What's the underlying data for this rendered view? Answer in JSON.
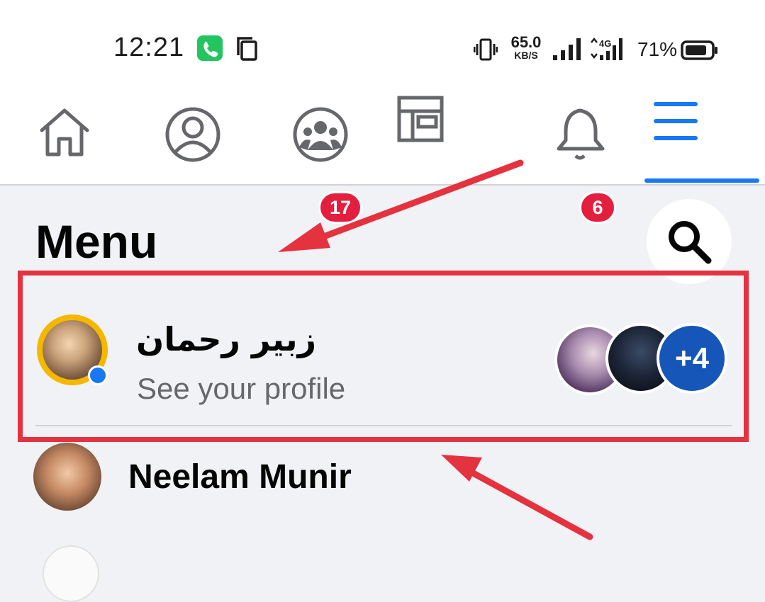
{
  "status_bar": {
    "time": "12:21",
    "speed_value": "65.0",
    "speed_unit": "KB/S",
    "battery_percent": "71%",
    "icons": [
      "call-icon",
      "copy-icon",
      "vibrate-icon",
      "signal-icon",
      "4g-signal-icon",
      "battery-icon"
    ]
  },
  "nav_tabs": [
    {
      "name": "home",
      "icon": "home-icon"
    },
    {
      "name": "profile",
      "icon": "profile-icon"
    },
    {
      "name": "groups",
      "icon": "groups-icon",
      "badge": "17"
    },
    {
      "name": "feeds",
      "icon": "feeds-icon"
    },
    {
      "name": "notifications",
      "icon": "bell-icon",
      "badge": "6"
    },
    {
      "name": "menu",
      "icon": "hamburger-icon",
      "active": true
    }
  ],
  "menu": {
    "title": "Menu",
    "profile": {
      "name": "زبیر رحمان",
      "subtitle": "See your profile",
      "extra_accounts": "+4"
    },
    "accounts": [
      {
        "name": "Neelam Munir"
      }
    ]
  },
  "colors": {
    "accent": "#1877f2",
    "badge": "#e41e3f",
    "annotation": "#e4323f",
    "background": "#f0f2f5"
  }
}
